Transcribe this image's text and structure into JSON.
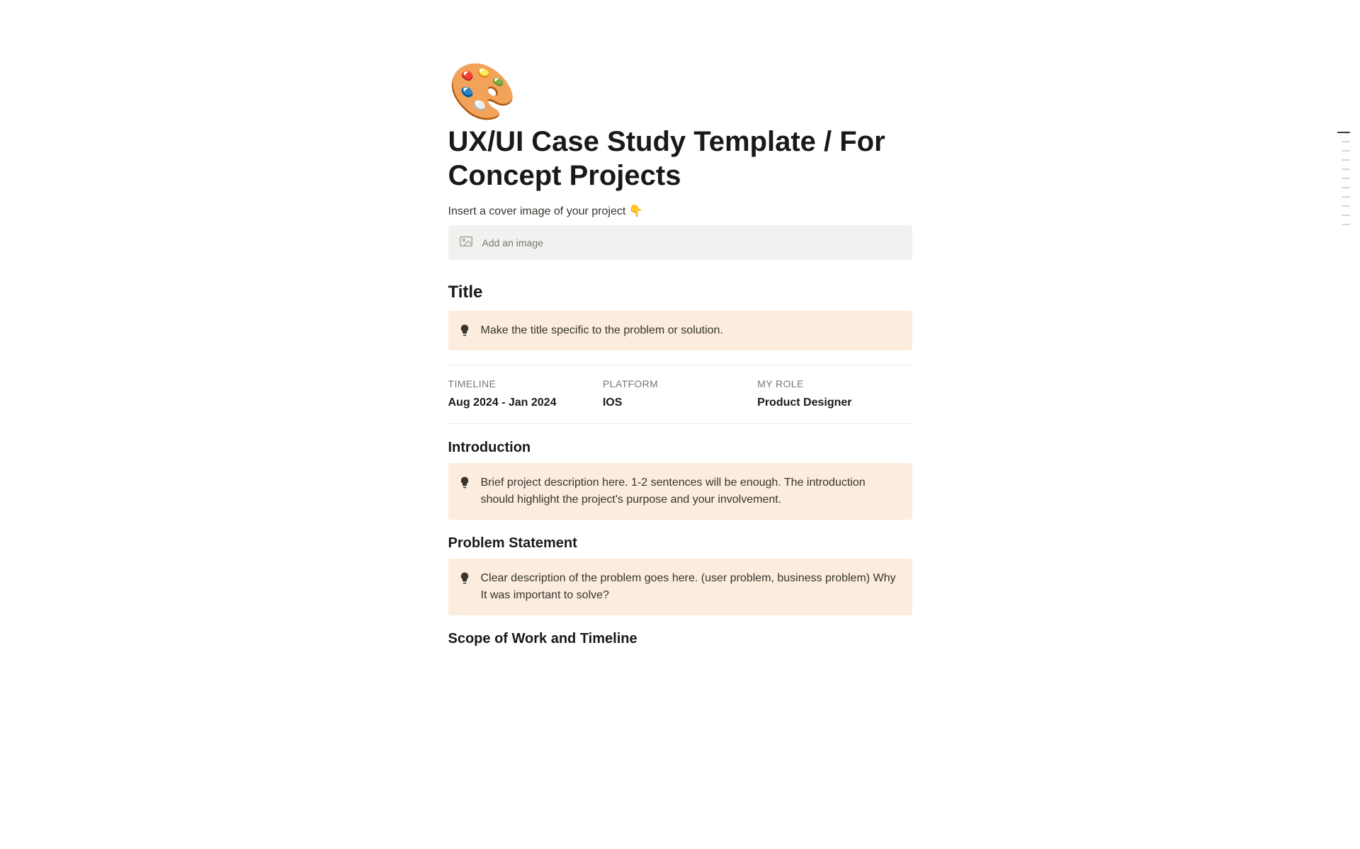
{
  "page": {
    "icon": "🎨",
    "title": "UX/UI Case Study Template / For Concept Projects",
    "subtitle": "Insert a cover image of your project 👇",
    "add_image_label": "Add an image"
  },
  "sections": {
    "title": {
      "heading": "Title",
      "callout": "Make the title specific to the problem or solution."
    },
    "meta": {
      "timeline_label": "TIMELINE",
      "timeline_value": "Aug 2024 - Jan 2024",
      "platform_label": "PLATFORM",
      "platform_value": "IOS",
      "role_label": "MY ROLE",
      "role_value": "Product Designer"
    },
    "introduction": {
      "heading": "Introduction",
      "callout": "Brief project description here. 1-2 sentences will be enough. The introduction should highlight the project's purpose and your involvement."
    },
    "problem": {
      "heading": "Problem Statement",
      "callout": "Clear description of the problem goes here. (user problem, business problem) Why It was important to solve?"
    },
    "scope": {
      "heading": "Scope of Work and Timeline"
    }
  }
}
